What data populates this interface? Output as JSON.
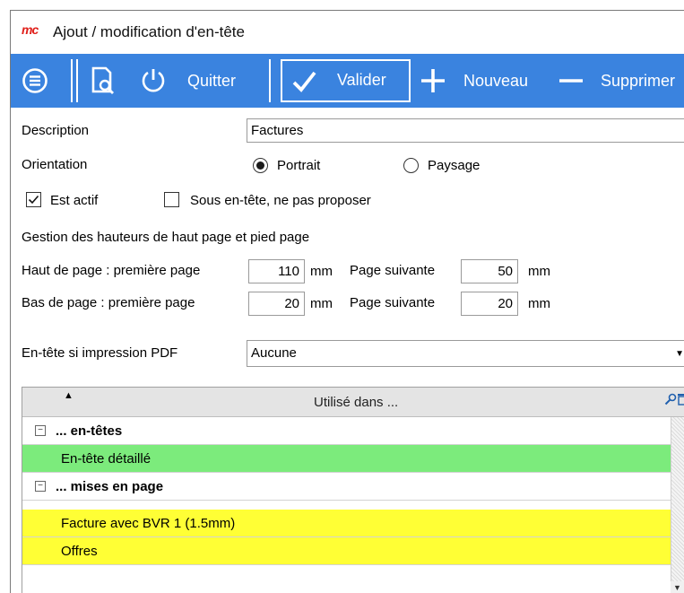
{
  "window": {
    "logo": "mc",
    "title": "Ajout / modification d'en-tête"
  },
  "toolbar": {
    "quit_label": "Quitter",
    "validate_label": "Valider",
    "new_label": "Nouveau",
    "delete_label": "Supprimer",
    "background_color": "#3a83df"
  },
  "form": {
    "description_label": "Description",
    "description_value": "Factures",
    "orientation_label": "Orientation",
    "orientation_options": [
      "Portrait",
      "Paysage"
    ],
    "orientation_selected": "Portrait",
    "active_label": "Est actif",
    "active_checked": true,
    "sub_header_label": "Sous en-tête, ne pas proposer",
    "sub_header_checked": false,
    "heights_title": "Gestion des hauteurs de haut page et pied page",
    "top_first_label": "Haut de page : première page",
    "top_first_value": "110",
    "top_next_label": "Page suivante",
    "top_next_value": "50",
    "bottom_first_label": "Bas de page  : première page",
    "bottom_first_value": "20",
    "bottom_next_label": "Page suivante",
    "bottom_next_value": "20",
    "unit": "mm",
    "pdf_header_label": "En-tête si impression PDF",
    "pdf_header_value": "Aucune"
  },
  "grid": {
    "header": "Utilisé dans ...",
    "rows": [
      {
        "type": "group",
        "label": "... en-têtes"
      },
      {
        "type": "item",
        "label": "En-tête détaillé",
        "color": "#7ceb7c"
      },
      {
        "type": "group",
        "label": "... mises en page"
      },
      {
        "type": "item",
        "label": "Facture avec BVR 1 (1.5mm)",
        "color": "#ffff35"
      },
      {
        "type": "item",
        "label": "Offres",
        "color": "#ffff35"
      }
    ]
  }
}
